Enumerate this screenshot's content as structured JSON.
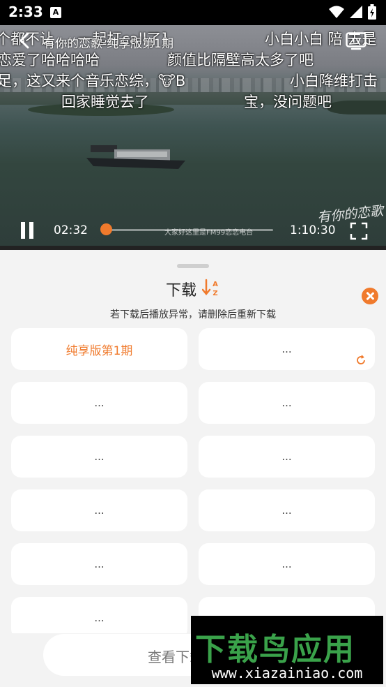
{
  "status_bar": {
    "time": "2:33",
    "notification_icon": "A"
  },
  "video": {
    "title": "有你的恋歌-纯享版第1期",
    "current_time": "02:32",
    "total_time": "1:10:30",
    "progress_fraction": 0.036,
    "track_caption": "大家好这里是FM99恋恋电台",
    "logo_text": "有你的恋歌",
    "danmaku": [
      {
        "text": "个都不让  ...  一起打call了]"
      },
      {
        "text": "小白小白   陪 去是"
      },
      {
        "text": "恋爱了哈哈哈哈"
      },
      {
        "text": "颜值比隔壁高太多了吧"
      },
      {
        "text": "足，这又来个音乐恋综，🐮B"
      },
      {
        "text": "小白降维打击"
      },
      {
        "text": "回家睡觉去了"
      },
      {
        "text": "宝，没问题吧"
      }
    ]
  },
  "sheet": {
    "title": "下载",
    "notice": "若下载后播放异常，请删除后重新下载",
    "episodes": [
      {
        "label": "纯享版第1期",
        "active": true
      },
      {
        "label": "...",
        "active": false,
        "loading": true
      },
      {
        "label": "...",
        "active": false
      },
      {
        "label": "...",
        "active": false
      },
      {
        "label": "...",
        "active": false
      },
      {
        "label": "...",
        "active": false
      },
      {
        "label": "...",
        "active": false
      },
      {
        "label": "...",
        "active": false
      },
      {
        "label": "...",
        "active": false
      },
      {
        "label": "...",
        "active": false
      },
      {
        "label": "...",
        "active": false
      },
      {
        "label": "...",
        "active": false
      }
    ],
    "view_downloads": "查看下载"
  },
  "watermark": {
    "brand": "下载鸟应用",
    "url": "www.xiazainiao.com"
  },
  "colors": {
    "accent": "#f07a2c",
    "sheet_bg": "#f3f3f3",
    "card_bg": "#ffffff"
  }
}
